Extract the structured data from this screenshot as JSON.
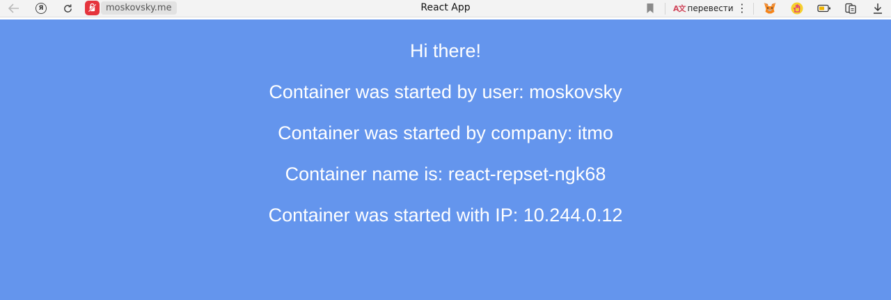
{
  "browser": {
    "url": "moskovsky.me",
    "title": "React App",
    "translate_label": "перевести",
    "translate_icon_text": "A文",
    "ya_label": "Я",
    "icons": [
      "back-arrow-icon",
      "yandex-icon",
      "reload-icon",
      "site-favicon",
      "bookmark-icon",
      "translate-icon",
      "more-icon",
      "metamask-fox-icon",
      "hand-extension-icon",
      "battery-icon",
      "tabs-icon",
      "download-icon"
    ]
  },
  "page": {
    "background": "#6495ed",
    "text_color": "#ffffff",
    "greeting": "Hi there!",
    "user_line": "Container was started by user: moskovsky",
    "company_line": "Container was started by company: itmo",
    "name_line": "Container name is: react-repset-ngk68",
    "ip_line": "Container was started with IP: 10.244.0.12"
  }
}
